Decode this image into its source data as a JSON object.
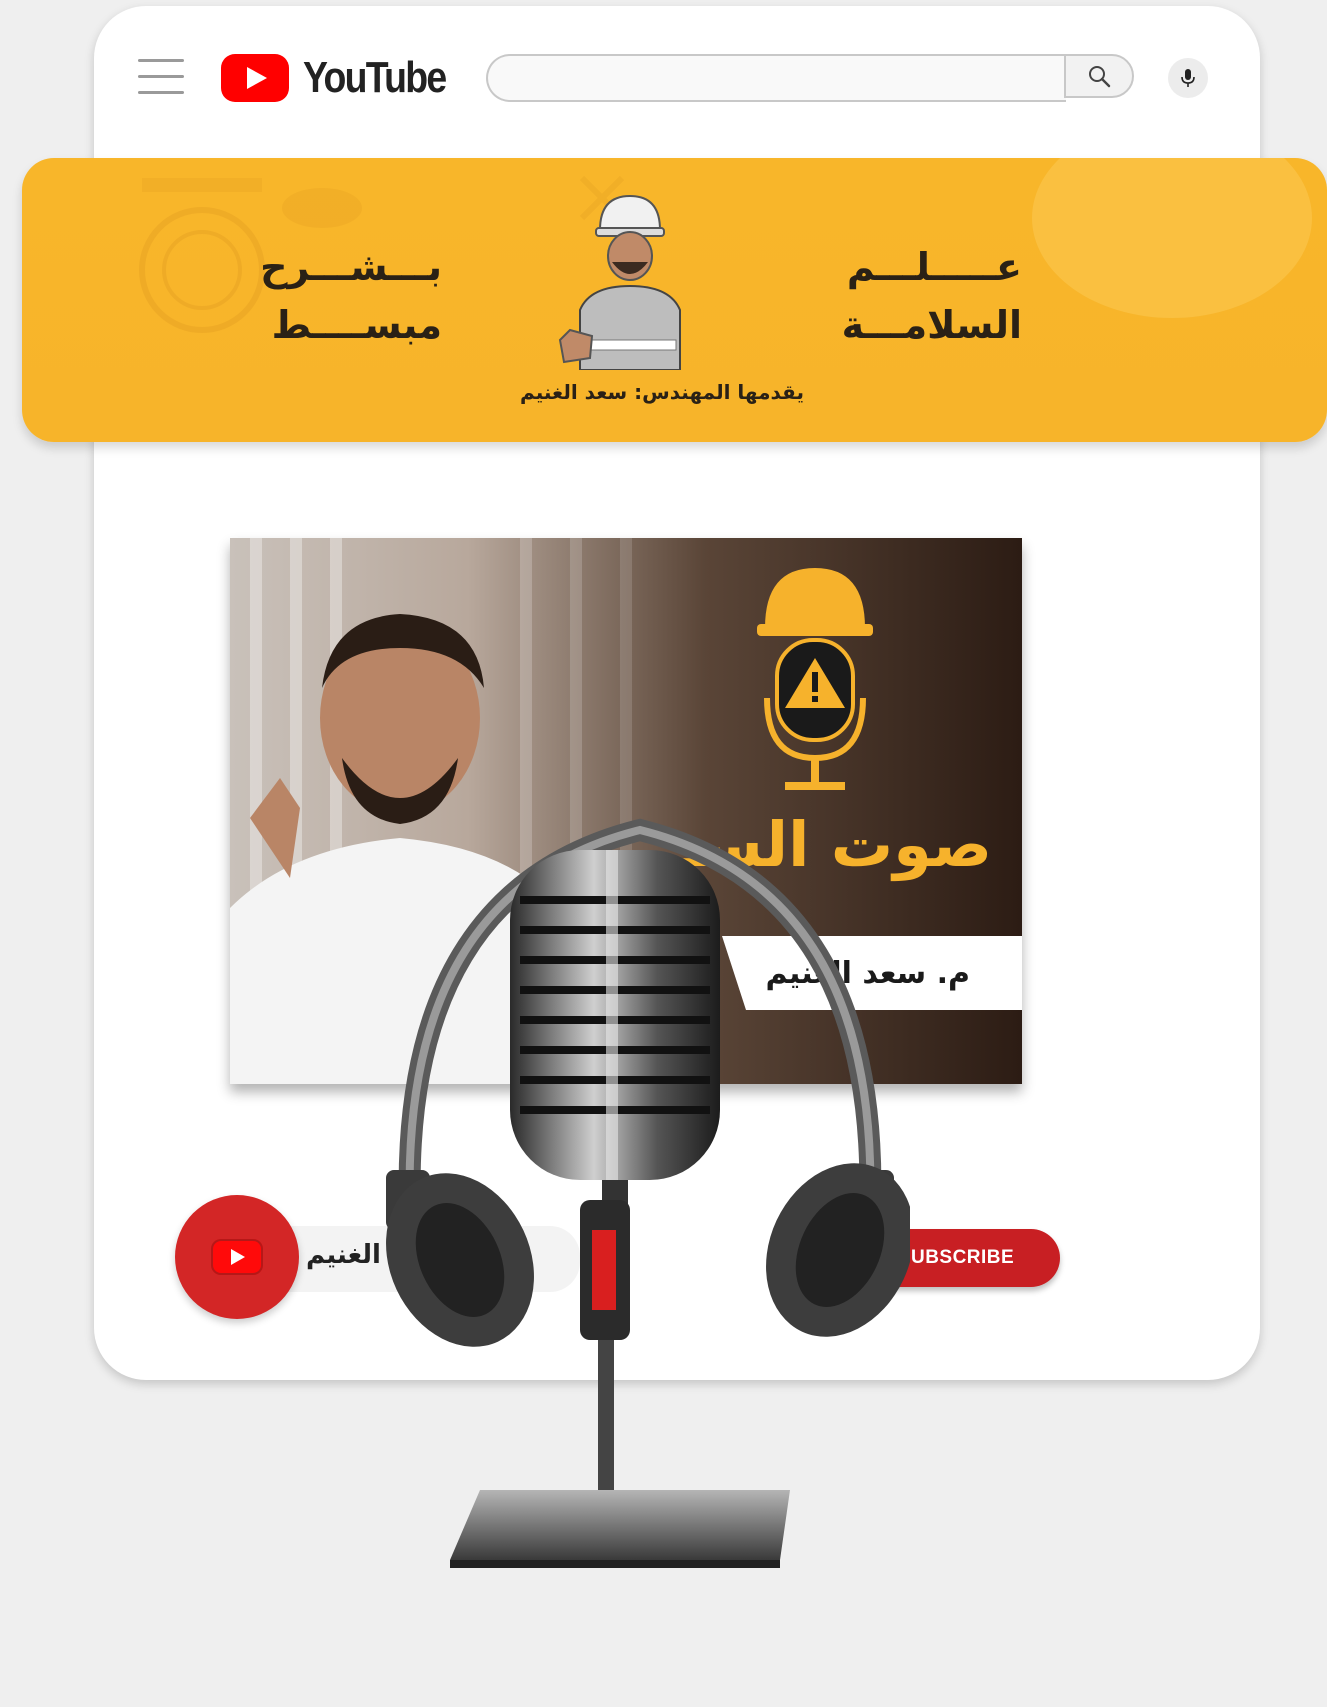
{
  "header": {
    "logo_text": "YouTube",
    "search_placeholder": ""
  },
  "banner": {
    "left_line1": "بـــشـــرح",
    "left_line2": "مبســــط",
    "right_line1": "عـــــلـــم",
    "right_line2": "السلامـــة",
    "caption": "يقدمها المهندس: سعد الغنيم"
  },
  "thumbnail": {
    "title": "صوت السـ",
    "name": "م. سعد الغنيم"
  },
  "channel": {
    "name": "د الغنيم"
  },
  "actions": {
    "subscribe_label": "SUBSCRIBE"
  },
  "colors": {
    "brand_red": "#ff0000",
    "banner_yellow": "#f8b62a",
    "subscribe_red": "#c81f23"
  },
  "icons": [
    "menu-icon",
    "youtube-logo-icon",
    "search-icon",
    "microphone-icon",
    "engineer-illustration",
    "warning-helmet-mic-icon",
    "youtube-play-icon",
    "podcast-microphone-headphones"
  ]
}
